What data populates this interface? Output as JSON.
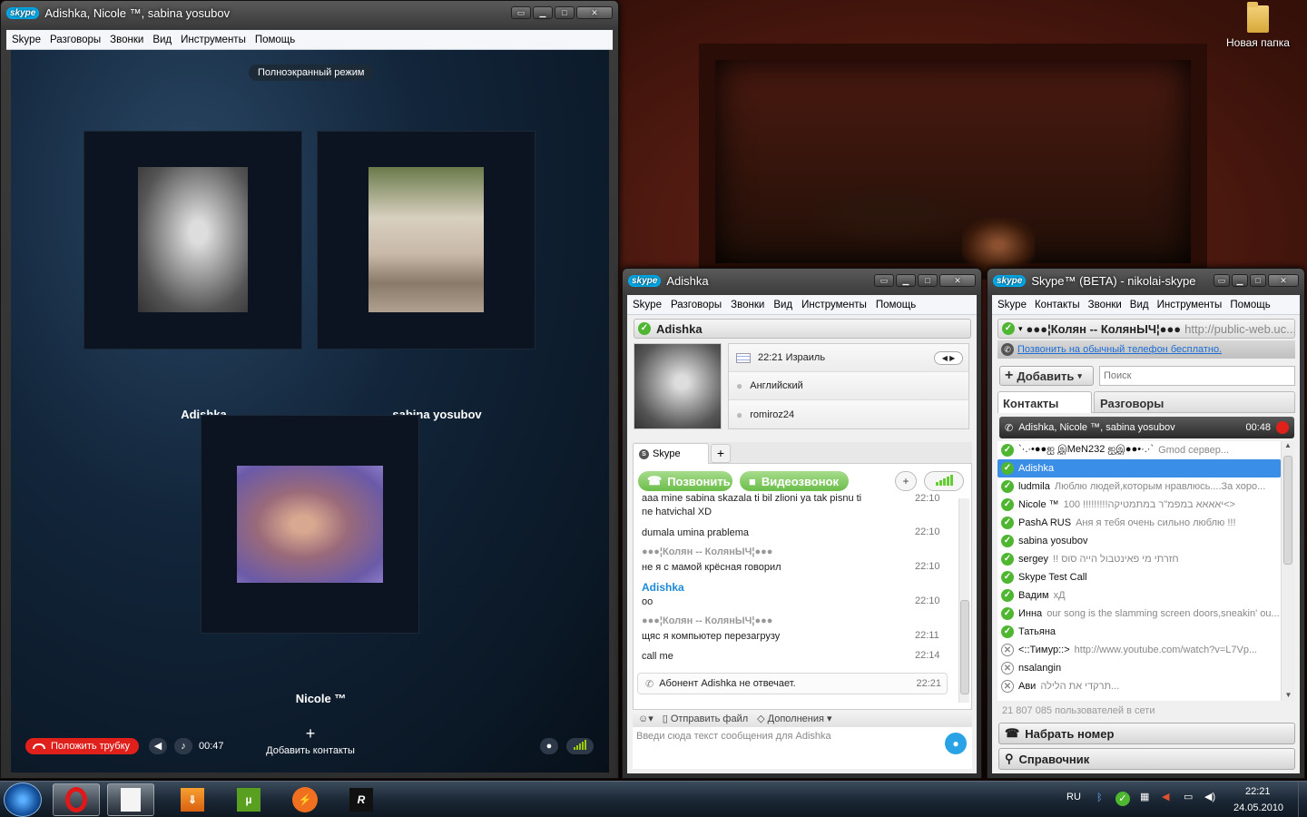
{
  "desktop": {
    "icon_label": "Новая папка"
  },
  "call_window": {
    "title": "Adishka, Nicole ™, sabina yosubov",
    "logo": "skype",
    "menu": [
      "Skype",
      "Разговоры",
      "Звонки",
      "Вид",
      "Инструменты",
      "Помощь"
    ],
    "fullscreen_label": "Полноэкранный режим",
    "participants": [
      {
        "name": "Adishka"
      },
      {
        "name": "sabina yosubov"
      },
      {
        "name": "Nicole ™"
      }
    ],
    "hangup_label": "Положить трубку",
    "time": "00:47",
    "add_contacts_label": "Добавить контакты"
  },
  "chat_window": {
    "title": "Adishka",
    "logo": "skype",
    "menu": [
      "Skype",
      "Разговоры",
      "Звонки",
      "Вид",
      "Инструменты",
      "Помощь"
    ],
    "contact_name": "Adishka",
    "info": {
      "time": "22:21 Израиль",
      "language": "Английский",
      "skype_name": "romiroz24"
    },
    "tab_label": "Skype",
    "call_label": "Позвонить",
    "video_label": "Видеозвонок",
    "messages": [
      {
        "text": "aaa mine sabina skazala ti bil zlioni ya tak pisnu ti ne hatvichal XD",
        "time": "22:10"
      },
      {
        "text": "dumala umina prablema",
        "time": "22:10"
      },
      {
        "sender": "●●●¦Колян -- КолянЫЧ¦●●●",
        "text": "не я с мамой крёсная говорил",
        "time": "22:10"
      },
      {
        "sender": "Adishka",
        "text": "oo",
        "time": "22:10"
      },
      {
        "sender": "●●●¦Колян -- КолянЫЧ¦●●●",
        "text": "щяс я компьютер перезагрузу",
        "time": "22:11"
      },
      {
        "text": "call me",
        "time": "22:14"
      }
    ],
    "not_answered": "Абонент Adishka не отвечает.",
    "not_answered_time": "22:21",
    "send_file_label": "Отправить файл",
    "extras_label": "Дополнения",
    "input_placeholder": "Введи сюда текст сообщения для Adishka"
  },
  "main_window": {
    "title": "Skype™ (BETA) - nikolai-skype",
    "logo": "skype",
    "menu": [
      "Skype",
      "Контакты",
      "Звонки",
      "Вид",
      "Инструменты",
      "Помощь"
    ],
    "me": "●●●¦Колян -- КолянЫЧ¦●●●",
    "mood_url": "http://public-web.uc...",
    "free_call_link": "Позвонить на обычный телефон бесплатно.",
    "add_label": "Добавить",
    "search_placeholder": "Поиск",
    "tabs": [
      "Контакты",
      "Разговоры"
    ],
    "active_call": {
      "names": "Adishka, Nicole ™, sabina yosubov",
      "time": "00:48"
    },
    "contacts": [
      {
        "name": "`·.·•●●ஐ இMeN232 ஐஇ●●•·.·`",
        "mood": "Gmod сервер...",
        "online": true
      },
      {
        "name": "Adishka",
        "mood": "",
        "online": true
      },
      {
        "name": "ludmila",
        "mood": "Люблю людей,которым нравлюсь....За хоро...",
        "online": true
      },
      {
        "name": "Nicole ™",
        "mood": "100 !!!!!!!!!יאאאא במפמ\"ר במתמטיקה<>",
        "online": true
      },
      {
        "name": "PashA RUS",
        "mood": "Аня я тебя очень сильно люблю !!!",
        "online": true
      },
      {
        "name": "sabina yosubov",
        "mood": "",
        "online": true
      },
      {
        "name": "sergey",
        "mood": "!! חזרתי מי פאינטבול הייה סוס",
        "online": true
      },
      {
        "name": "Skype Test Call",
        "mood": "",
        "online": true
      },
      {
        "name": "Вадим",
        "mood": "хД",
        "online": true
      },
      {
        "name": "Инна",
        "mood": "our song is the slamming screen doors,sneakin' ou...",
        "online": true
      },
      {
        "name": "Татьяна",
        "mood": "",
        "online": true
      },
      {
        "name": "<::Тимур::>",
        "mood": "http://www.youtube.com/watch?v=L7Vp...",
        "online": false
      },
      {
        "name": "nsalangin",
        "mood": "",
        "online": false
      },
      {
        "name": "Ави",
        "mood": "תרקדי את הלילה...",
        "online": false
      }
    ],
    "users_online": "21 807 085 пользователей в сети",
    "dial_label": "Набрать номер",
    "directory_label": "Справочник"
  },
  "taskbar": {
    "lang": "RU",
    "time": "22:21",
    "date": "24.05.2010"
  }
}
